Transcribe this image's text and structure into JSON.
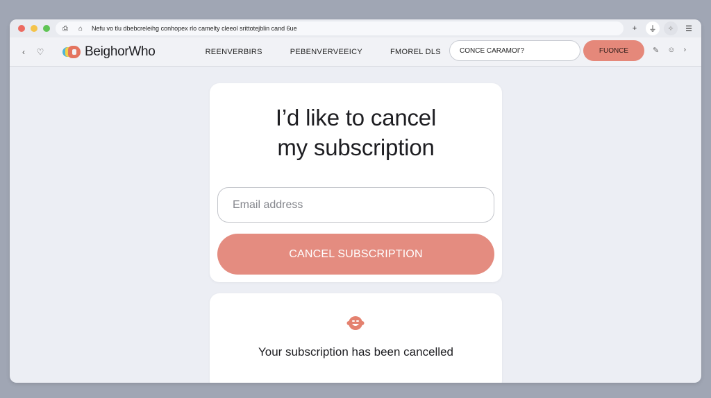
{
  "browser": {
    "url_text": "Nefu vo tlu dbebcreleihg conhopex rlo camelty cleeol srittotejblin cand 6ue",
    "toolbar_icons": [
      "plus-icon",
      "extension-icon",
      "sync-icon",
      "menu-icon"
    ]
  },
  "navbar": {
    "back_glyph": "‹",
    "forward_glyph": "›",
    "brand": "BeighorWho",
    "links": [
      "REENVERBIRS",
      "PEBENVERVEEICY",
      "FMOREL DLS"
    ],
    "search_value": "CONCE CARAMOI'?",
    "cta_label": "FUONCE",
    "colors": {
      "accent": "#e5887a"
    }
  },
  "main_card": {
    "headline_line1": "I’d like to cancel",
    "headline_line2": "my subscription",
    "email_placeholder": "Email address",
    "email_value": "",
    "cancel_button_label": "CANCEL SUBSCRIPTION",
    "button_color": "#e48c80"
  },
  "confirmation": {
    "icon": "smiley-face-icon",
    "message": "Your subscription has been cancelled"
  }
}
